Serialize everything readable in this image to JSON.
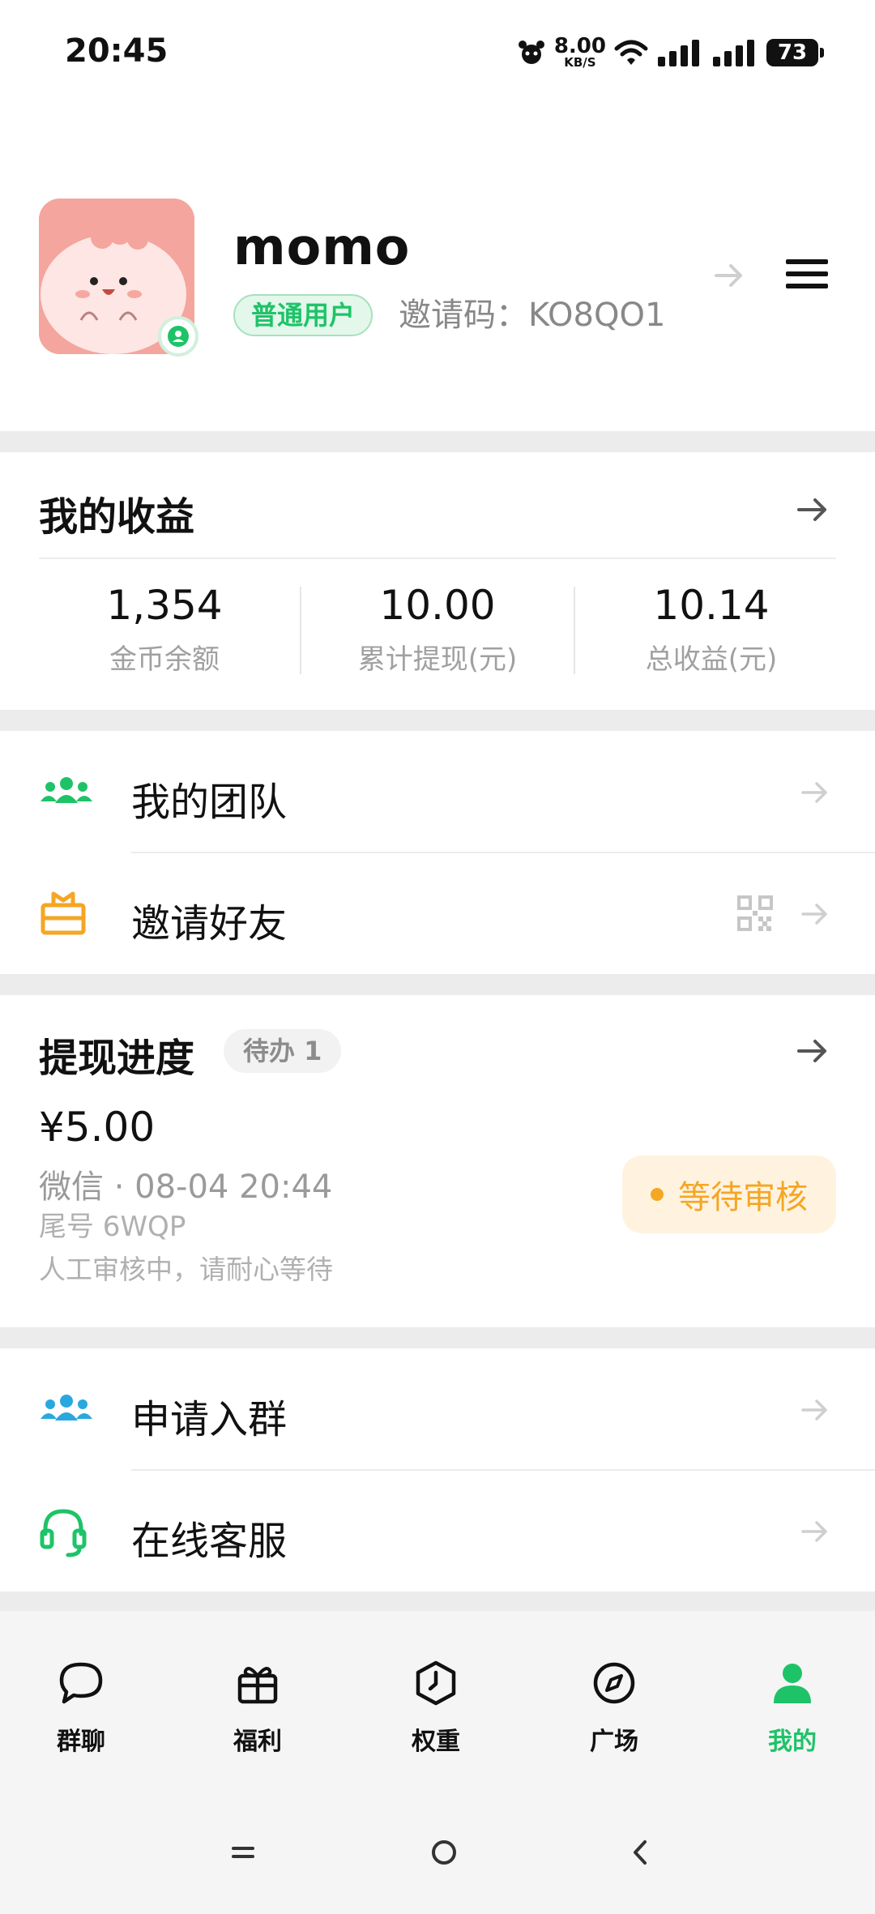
{
  "status_bar": {
    "time": "20:45",
    "net_speed": "8.00",
    "net_unit": "KB/S",
    "battery": "73"
  },
  "profile": {
    "username": "momo",
    "user_tag": "普通用户",
    "invite_code": "邀请码：KO8QO1"
  },
  "earnings": {
    "title": "我的收益",
    "stats": [
      {
        "value": "1,354",
        "label": "金币余额"
      },
      {
        "value": "10.00",
        "label": "累计提现(元)"
      },
      {
        "value": "10.14",
        "label": "总收益(元)"
      }
    ]
  },
  "menu1": [
    {
      "label": "我的团队",
      "icon": "team-icon"
    },
    {
      "label": "邀请好友",
      "icon": "gift-box-icon"
    }
  ],
  "withdraw": {
    "title": "提现进度",
    "todo": "待办 1",
    "amount": "¥5.00",
    "method_time": "微信 · 08-04 20:44",
    "tail": "尾号 6WQP",
    "note": "人工审核中，请耐心等待",
    "status": "等待审核"
  },
  "menu2": [
    {
      "label": "申请入群",
      "icon": "group-icon"
    },
    {
      "label": "在线客服",
      "icon": "headset-icon"
    }
  ],
  "tabs": [
    {
      "label": "群聊",
      "icon": "chat-icon"
    },
    {
      "label": "福利",
      "icon": "gift-icon"
    },
    {
      "label": "权重",
      "icon": "clock-hexagon-icon"
    },
    {
      "label": "广场",
      "icon": "compass-icon"
    },
    {
      "label": "我的",
      "icon": "person-icon",
      "active": true
    }
  ],
  "colors": {
    "accent": "#1ec368",
    "pending": "#f5a623",
    "team_icon": "#1ec368",
    "invite_icon": "#f5a623",
    "group_icon": "#29a8e0"
  }
}
